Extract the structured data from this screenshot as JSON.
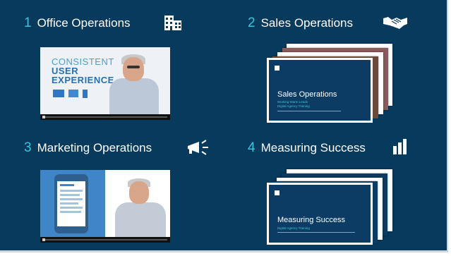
{
  "sections": [
    {
      "number": "1",
      "title": "Office Operations",
      "icon": "office-building-icon"
    },
    {
      "number": "2",
      "title": "Sales Operations",
      "icon": "handshake-icon"
    },
    {
      "number": "3",
      "title": "Marketing Operations",
      "icon": "megaphone-icon"
    },
    {
      "number": "4",
      "title": "Measuring Success",
      "icon": "bar-chart-icon"
    }
  ],
  "video1": {
    "caption_line1": "CONSISTENT",
    "caption_line2": "USER",
    "caption_line3": "EXPERIENCE"
  },
  "deck_sales": {
    "title": "Sales Operations",
    "subtitle_line1": "Working Warm Leads",
    "subtitle_line2": "Digital Agency Training"
  },
  "deck_measuring": {
    "title": "Measuring Success",
    "subtitle_line1": "Digital Agency Training"
  },
  "colors": {
    "background": "#073a5d",
    "accent_number": "#38c6d9",
    "text": "#ffffff"
  }
}
